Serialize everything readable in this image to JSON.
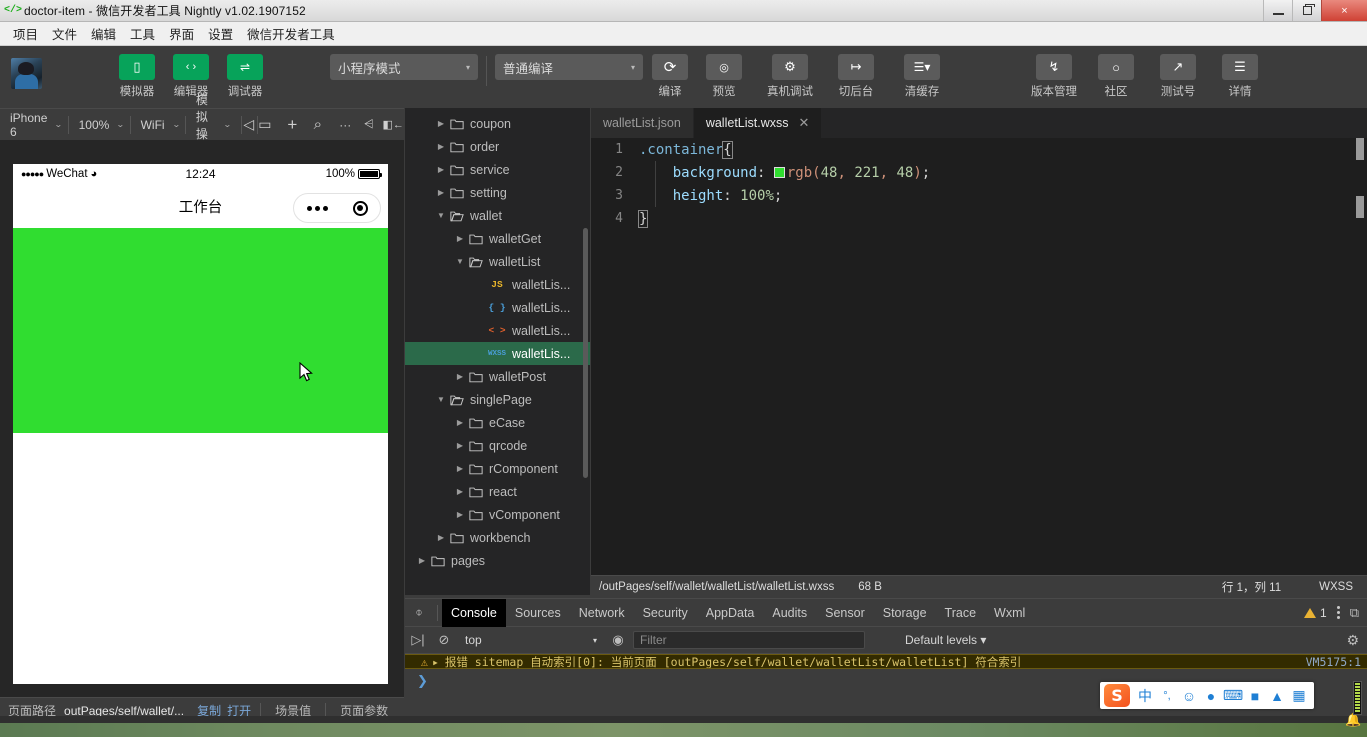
{
  "window": {
    "title": "doctor-item - 微信开发者工具 Nightly v1.02.1907152",
    "app_icon": "code-icon",
    "controls": {
      "minimize": "minimize-icon",
      "maximize": "maximize-icon",
      "close": "×"
    }
  },
  "menubar": {
    "items": [
      "项目",
      "文件",
      "编辑",
      "工具",
      "界面",
      "设置",
      "微信开发者工具"
    ]
  },
  "toolbar": {
    "avatar": "user-avatar",
    "buttons": [
      {
        "label": "模拟器",
        "icon": "phone-icon",
        "glyph": "▯",
        "style": "green"
      },
      {
        "label": "编辑器",
        "icon": "code-brackets-icon",
        "glyph": "‹ ›",
        "style": "green"
      },
      {
        "label": "调试器",
        "icon": "debug-sliders-icon",
        "glyph": "⇌",
        "style": "green"
      }
    ],
    "mode_select": {
      "value": "小程序模式",
      "caret": "▾"
    },
    "compile_select": {
      "value": "普通编译",
      "caret": "▾"
    },
    "actions": [
      {
        "label": "编译",
        "icon": "refresh-icon",
        "glyph": "⟳"
      },
      {
        "label": "预览",
        "icon": "eye-icon",
        "glyph": "◉"
      },
      {
        "label": "真机调试",
        "icon": "bug-icon",
        "glyph": "🐞"
      },
      {
        "label": "切后台",
        "icon": "background-icon",
        "glyph": "↦"
      },
      {
        "label": "清缓存",
        "icon": "layers-icon",
        "glyph": "≋",
        "has_caret": true
      }
    ],
    "right_actions": [
      {
        "label": "版本管理",
        "icon": "git-branch-icon",
        "glyph": "⑂"
      },
      {
        "label": "社区",
        "icon": "chat-bubble-icon",
        "glyph": "💬"
      },
      {
        "label": "测试号",
        "icon": "external-link-icon",
        "glyph": "↗"
      },
      {
        "label": "详情",
        "icon": "hamburger-icon",
        "glyph": "☰"
      }
    ]
  },
  "simulator": {
    "toolbar": {
      "device": {
        "value": "iPhone 6",
        "caret": "⌄"
      },
      "zoom": {
        "value": "100%",
        "caret": "⌄"
      },
      "network": {
        "value": "WiFi",
        "caret": "⌄"
      },
      "mock": {
        "value": "模拟操作",
        "caret": "⌄"
      },
      "icons": [
        {
          "name": "mute-icon",
          "glyph": "◁"
        },
        {
          "name": "screen-icon",
          "glyph": "▭"
        },
        {
          "name": "add-icon",
          "glyph": "+"
        },
        {
          "name": "search-icon",
          "glyph": "⌕"
        },
        {
          "name": "more-icon",
          "glyph": "···"
        },
        {
          "name": "compare-icon",
          "glyph": "⩤"
        },
        {
          "name": "collapse-panel-icon",
          "glyph": "◧←"
        }
      ]
    },
    "phone": {
      "status": {
        "carrier": "WeChat",
        "dots": "●●●●●",
        "wifi": "wifi-icon",
        "time": "12:24",
        "battery_pct": "100%"
      },
      "nav_title": "工作台",
      "capsule": {
        "more": "more-dots-icon",
        "target": "target-circle-icon"
      },
      "content_color": "#30dd30"
    },
    "footer": {
      "path_label": "页面路径",
      "path_value": "outPages/self/wallet/...",
      "copy": "复制",
      "open": "打开",
      "scene": "场景值",
      "params": "页面参数"
    }
  },
  "file_tree": {
    "items": [
      {
        "label": "coupon",
        "depth": 1,
        "type": "folder",
        "state": "collapsed"
      },
      {
        "label": "order",
        "depth": 1,
        "type": "folder",
        "state": "collapsed"
      },
      {
        "label": "service",
        "depth": 1,
        "type": "folder",
        "state": "collapsed"
      },
      {
        "label": "setting",
        "depth": 1,
        "type": "folder",
        "state": "collapsed"
      },
      {
        "label": "wallet",
        "depth": 1,
        "type": "folder",
        "state": "expanded"
      },
      {
        "label": "walletGet",
        "depth": 2,
        "type": "folder",
        "state": "collapsed"
      },
      {
        "label": "walletList",
        "depth": 2,
        "type": "folder",
        "state": "expanded"
      },
      {
        "label": "walletLis...",
        "depth": 3,
        "type": "file",
        "ext": "JS",
        "ext_color": "#e8b52b"
      },
      {
        "label": "walletLis...",
        "depth": 3,
        "type": "file",
        "ext": "{ }",
        "ext_color": "#4a9ed8"
      },
      {
        "label": "walletLis...",
        "depth": 3,
        "type": "file",
        "ext": "< >",
        "ext_color": "#e0602c"
      },
      {
        "label": "walletLis...",
        "depth": 3,
        "type": "file",
        "ext": "WXSS",
        "ext_color": "#4a9ed8",
        "active": true
      },
      {
        "label": "walletPost",
        "depth": 2,
        "type": "folder",
        "state": "collapsed"
      },
      {
        "label": "singlePage",
        "depth": 1,
        "type": "folder",
        "state": "expanded"
      },
      {
        "label": "eCase",
        "depth": 2,
        "type": "folder",
        "state": "collapsed"
      },
      {
        "label": "qrcode",
        "depth": 2,
        "type": "folder",
        "state": "collapsed"
      },
      {
        "label": "rComponent",
        "depth": 2,
        "type": "folder",
        "state": "collapsed"
      },
      {
        "label": "react",
        "depth": 2,
        "type": "folder",
        "state": "collapsed"
      },
      {
        "label": "vComponent",
        "depth": 2,
        "type": "folder",
        "state": "collapsed"
      },
      {
        "label": "workbench",
        "depth": 1,
        "type": "folder",
        "state": "collapsed"
      },
      {
        "label": "pages",
        "depth": 0,
        "type": "folder",
        "state": "collapsed"
      }
    ]
  },
  "editor": {
    "tabs": [
      {
        "label": "walletList.json",
        "active": false,
        "closable": false
      },
      {
        "label": "walletList.wxss",
        "active": true,
        "closable": true,
        "close": "✕"
      }
    ],
    "lines": [
      {
        "num": "1",
        "text": ".container{"
      },
      {
        "num": "2",
        "text": "    background: rgb(48, 221, 48);"
      },
      {
        "num": "3",
        "text": "    height: 100%;"
      },
      {
        "num": "4",
        "text": "}"
      }
    ],
    "color_swatch": "#30dd30",
    "status": {
      "path": "/outPages/self/wallet/walletList/walletList.wxss",
      "size": "68 B",
      "cursor": "行 1，列 11",
      "language": "WXSS"
    }
  },
  "devtools": {
    "tabs": [
      "Console",
      "Sources",
      "Network",
      "Security",
      "AppData",
      "Audits",
      "Sensor",
      "Storage",
      "Trace",
      "Wxml"
    ],
    "active_tab": "Console",
    "inspect_icon": "cursor-select-icon",
    "warning_count": "1",
    "warning_icon": "warning-triangle-icon",
    "kebab_icon": "kebab-menu-icon",
    "dock_icon": "dock-panel-icon",
    "console_bar": {
      "execute_icon": "execute-icon",
      "clear_icon": "clear-console-icon",
      "context": "top",
      "eye_icon": "live-expression-icon",
      "filter_placeholder": "Filter",
      "levels": "Default levels ▾",
      "settings_icon": "gear-icon"
    },
    "warning_message": "报错 sitemap 自动索引[0]: 当前页面 [outPages/self/wallet/walletList/walletList] 符合索引",
    "warning_source": "VM5175:1",
    "prompt": "❯"
  },
  "tray": {
    "ime_logo": "S",
    "ime_icons": [
      {
        "name": "chinese-mode-icon",
        "glyph": "中"
      },
      {
        "name": "punctuation-icon",
        "glyph": "°,"
      },
      {
        "name": "emoji-icon",
        "glyph": "☺"
      },
      {
        "name": "voice-input-icon",
        "glyph": "🎤"
      },
      {
        "name": "soft-keyboard-icon",
        "glyph": "⌨"
      },
      {
        "name": "user-icon",
        "glyph": "👤"
      },
      {
        "name": "skin-icon",
        "glyph": "👕"
      },
      {
        "name": "toolbox-icon",
        "glyph": "▦"
      }
    ],
    "bell_icon": "notification-bell-icon"
  }
}
